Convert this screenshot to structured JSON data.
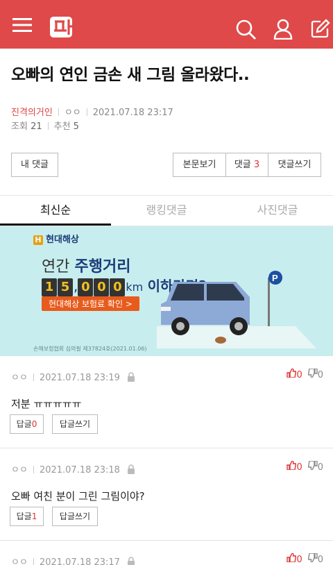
{
  "header": {
    "logo_text": "판",
    "brand_color": "#df4949"
  },
  "post": {
    "title": "오빠의 연인 금손 새 그림 올라왔다..",
    "author": "진격의거인",
    "user": "ㅇㅇ",
    "date": "2021.07.18 23:17",
    "views_label": "조회",
    "views": "21",
    "likes_label": "추천",
    "likes": "5"
  },
  "actions": {
    "my_comments": "내 댓글",
    "view_body": "본문보기",
    "comments_label": "댓글",
    "comments_count": "3",
    "write_comment": "댓글쓰기"
  },
  "tabs": [
    {
      "label": "최신순",
      "active": true
    },
    {
      "label": "랭킹댓글",
      "active": false
    },
    {
      "label": "사진댓글",
      "active": false
    }
  ],
  "ad": {
    "brand": "현대해상",
    "line1_prefix": "연간",
    "line1_bold": "주행거리",
    "digits_a": [
      "1",
      "5"
    ],
    "comma": ",",
    "digits_b": [
      "0",
      "0",
      "0"
    ],
    "unit": "km",
    "line2_suffix": "이하라면?",
    "cta": "현대해상 보험료 확인 >",
    "note": "손해보험협회 심의필 제37824호(2021.01.06)"
  },
  "comments": [
    {
      "user": "ㅇㅇ",
      "date": "2021.07.18 23:19",
      "up": "0",
      "down": "0",
      "text": "저분 ㅠㅠㅠㅠㅠ",
      "reply_label": "답글",
      "reply_count": "0",
      "write_reply": "답글쓰기"
    },
    {
      "user": "ㅇㅇ",
      "date": "2021.07.18 23:18",
      "up": "0",
      "down": "0",
      "text": "오빠 여친 분이 그린 그림이야?",
      "reply_label": "답글",
      "reply_count": "1",
      "write_reply": "답글쓰기"
    },
    {
      "user": "ㅇㅇ",
      "date": "2021.07.18 23:17",
      "up": "0",
      "down": "0"
    }
  ]
}
